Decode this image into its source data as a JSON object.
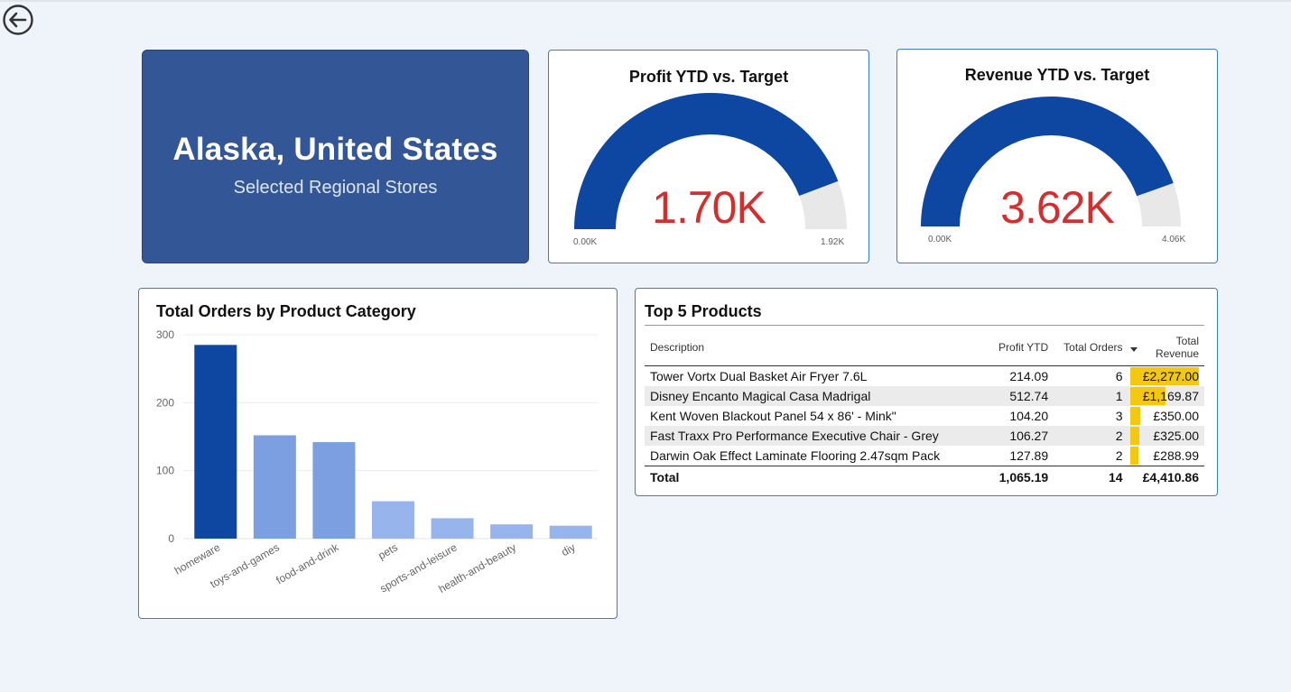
{
  "region": {
    "title": "Alaska, United States",
    "subtitle": "Selected Regional Stores"
  },
  "gauges": [
    {
      "title": "Profit YTD vs. Target",
      "value_label": "1.70K",
      "value": 1.7,
      "max": 1.92,
      "min_label": "0.00K",
      "max_label": "1.92K"
    },
    {
      "title": "Revenue YTD vs. Target",
      "value_label": "3.62K",
      "value": 3.62,
      "max": 4.06,
      "min_label": "0.00K",
      "max_label": "4.06K"
    }
  ],
  "colors": {
    "accent": "#0d47a1",
    "gauge_fill": "#0d47a1",
    "gauge_track": "#e8e8e8",
    "value_red": "#d32f2f",
    "bar_light": "#7b9fe0",
    "bar_lighter": "#97b4ec",
    "data_bar": "#f2c811",
    "region_bg": "#335697"
  },
  "chart_card": {
    "title": "Total Orders by Product Category"
  },
  "chart_data": {
    "type": "bar",
    "title": "Total Orders by Product Category",
    "categories": [
      "homeware",
      "toys-and-games",
      "food-and-drink",
      "pets",
      "sports-and-leisure",
      "health-and-beauty",
      "diy"
    ],
    "values": [
      285,
      152,
      142,
      55,
      30,
      21,
      19
    ],
    "ylim": [
      0,
      300
    ],
    "yticks": [
      "0",
      "100",
      "200",
      "300"
    ],
    "grid": true
  },
  "top5": {
    "title": "Top 5 Products",
    "columns": [
      "Description",
      "Profit YTD",
      "Total Orders",
      "Total Revenue"
    ],
    "rows": [
      {
        "description": "Tower Vortx Dual Basket Air Fryer 7.6L",
        "profit": "214.09",
        "orders": "6",
        "revenue": "£2,277.00",
        "revenue_value": 2277.0
      },
      {
        "description": "Disney Encanto Magical Casa Madrigal",
        "profit": "512.74",
        "orders": "1",
        "revenue": "£1,169.87",
        "revenue_value": 1169.87
      },
      {
        "description": "Kent Woven Blackout Panel 54 x 86' - Mink\"",
        "profit": "104.20",
        "orders": "3",
        "revenue": "£350.00",
        "revenue_value": 350.0
      },
      {
        "description": "Fast Traxx Pro Performance Executive Chair - Grey",
        "profit": "106.27",
        "orders": "2",
        "revenue": "£325.00",
        "revenue_value": 325.0
      },
      {
        "description": "Darwin Oak Effect Laminate Flooring 2.47sqm Pack",
        "profit": "127.89",
        "orders": "2",
        "revenue": "£288.99",
        "revenue_value": 288.99
      }
    ],
    "total": {
      "label": "Total",
      "profit": "1,065.19",
      "orders": "14",
      "revenue": "£4,410.86"
    }
  },
  "icons": {
    "back": "back-arrow-icon",
    "sort": "sort-descending-icon"
  }
}
